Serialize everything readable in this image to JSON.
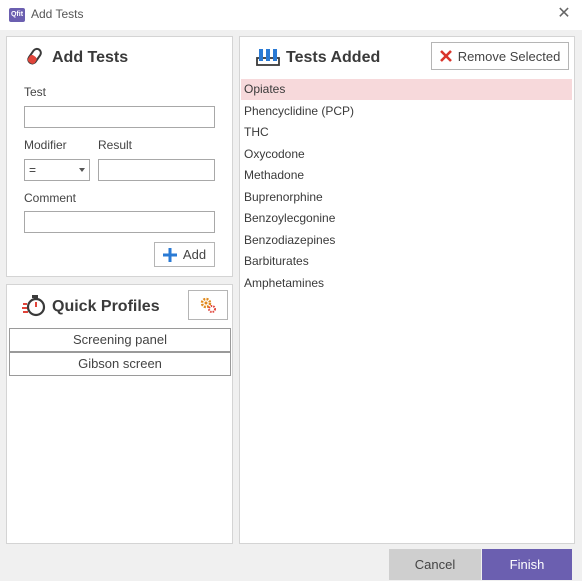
{
  "window": {
    "title": "Add Tests",
    "app_icon_text": "Qfit",
    "close_glyph": "✕"
  },
  "add_tests": {
    "title": "Add Tests",
    "test_label": "Test",
    "test_value": "",
    "modifier_label": "Modifier",
    "modifier_value": "=",
    "result_label": "Result",
    "result_value": "",
    "comment_label": "Comment",
    "comment_value": "",
    "add_label": "Add"
  },
  "quick_profiles": {
    "title": "Quick Profiles",
    "items": [
      "Screening panel",
      "Gibson screen"
    ]
  },
  "tests_added": {
    "title": "Tests Added",
    "remove_label": "Remove Selected",
    "items": [
      "Opiates",
      "Phencyclidine (PCP)",
      "THC",
      "Oxycodone",
      "Methadone",
      "Buprenorphine",
      "Benzoylecgonine",
      "Benzodiazepines",
      "Barbiturates",
      "Amphetamines"
    ],
    "selected_index": 0
  },
  "footer": {
    "cancel_label": "Cancel",
    "finish_label": "Finish"
  },
  "colors": {
    "accent": "#6b5fb0",
    "selected_row": "#f7d9db",
    "remove_red": "#d9342b",
    "add_blue": "#2a7ad4",
    "icon_red": "#e0443a"
  }
}
